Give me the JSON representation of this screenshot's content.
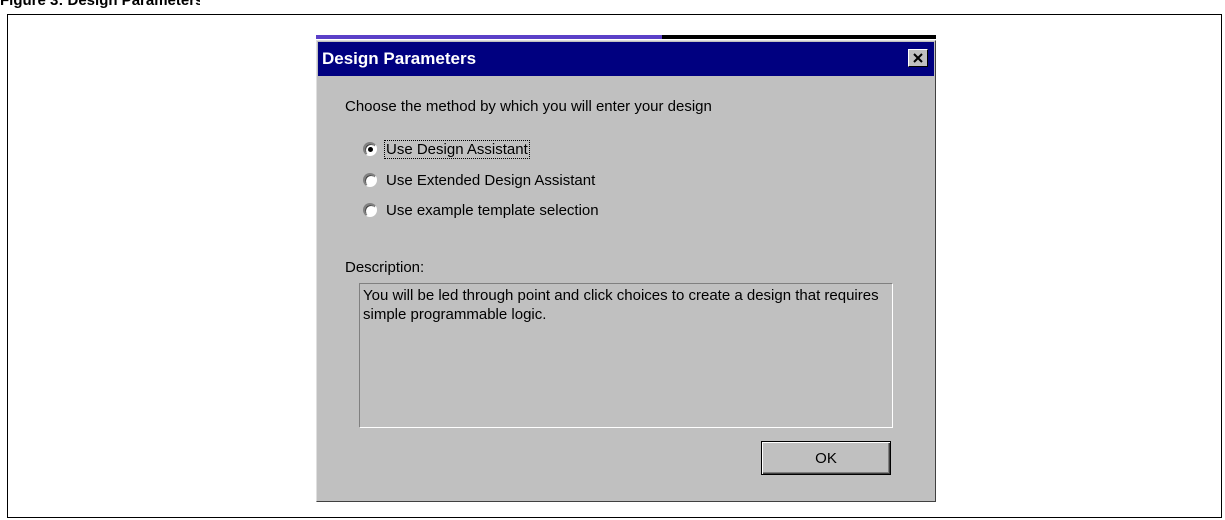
{
  "document": {
    "header_text": "Figure 3: Design Parameters"
  },
  "dialog": {
    "title": "Design Parameters",
    "instructions": "Choose the method by which you will enter your design",
    "options": [
      {
        "label": "Use Design Assistant",
        "selected": true
      },
      {
        "label": "Use Extended Design Assistant",
        "selected": false
      },
      {
        "label": "Use example template selection",
        "selected": false
      }
    ],
    "description_label": "Description:",
    "description_text": "You will be led through point and click choices to create a design that requires simple programmable logic.",
    "ok_label": "OK"
  },
  "colors": {
    "titlebar": "#000080",
    "dialog_face": "#c0c0c0",
    "background_strip": "#5b40c8"
  },
  "icons": {
    "close": "close-icon"
  }
}
